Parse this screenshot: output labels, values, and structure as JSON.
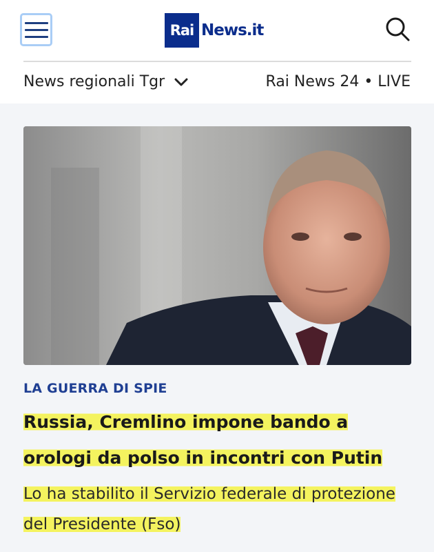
{
  "header": {
    "logo_rai": "Rai",
    "logo_news": "News.it",
    "menu_icon": "hamburger-menu-icon",
    "search_icon": "search-icon"
  },
  "subnav": {
    "regional_label": "News regionali Tgr",
    "live_label": "Rai News 24 • LIVE"
  },
  "article": {
    "image_alt": "Vladimir Putin",
    "kicker": "LA GUERRA DI SPIE",
    "headline": "Russia, Cremlino impone bando a orologi da polso in incontri con Putin",
    "summary": "Lo ha stabilito il Servizio federale di protezione del Presidente (Fso)"
  },
  "colors": {
    "brand": "#0b2d8c",
    "kicker": "#1f3f93",
    "highlight": "#f4f35f"
  }
}
